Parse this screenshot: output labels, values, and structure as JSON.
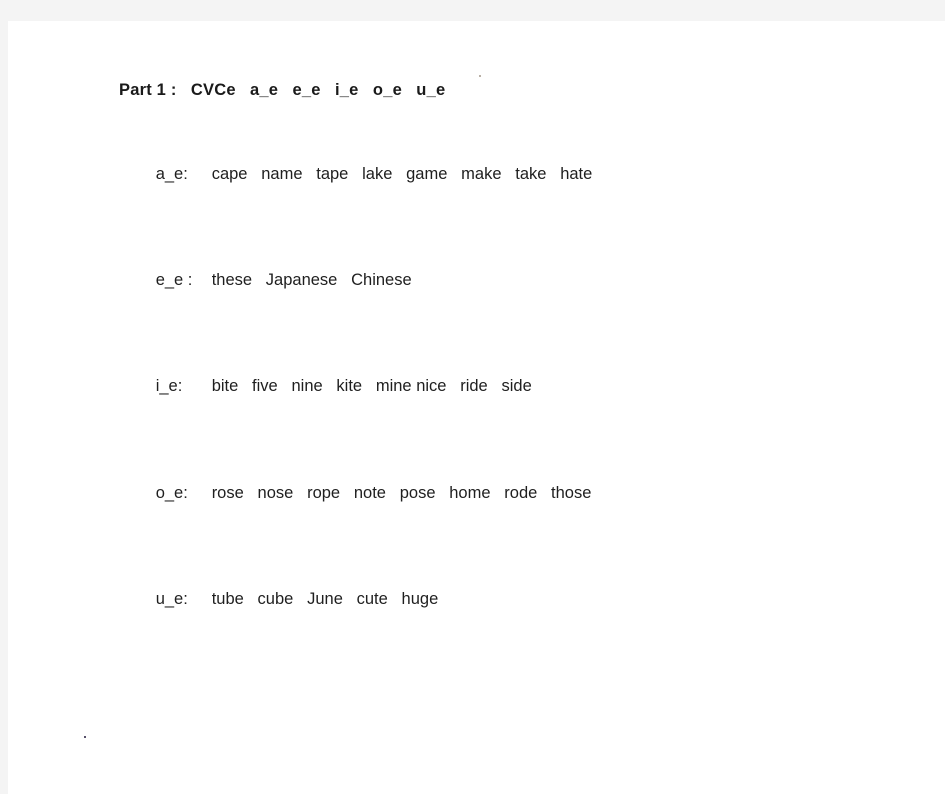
{
  "document": {
    "title_line": "Part 1 :   CVCe   a_e   e_e   i_e   o_e   u_e",
    "rows": [
      {
        "label": "a_e:",
        "words_text": "cape   name   tape   lake   game   make   take   hate",
        "words": [
          "cape",
          "name",
          "tape",
          "lake",
          "game",
          "make",
          "take",
          "hate"
        ]
      },
      {
        "label": "e_e :",
        "words_text": "these   Japanese   Chinese",
        "words": [
          "these",
          "Japanese",
          "Chinese"
        ]
      },
      {
        "label": "i_e:",
        "words_text": "bite   five   nine   kite   mine nice   ride   side",
        "words": [
          "bite",
          "five",
          "nine",
          "kite",
          "mine",
          "nice",
          "ride",
          "side"
        ]
      },
      {
        "label": "o_e:",
        "words_text": "rose   nose   rope   note   pose   home   rode   those",
        "words": [
          "rose",
          "nose",
          "rope",
          "note",
          "pose",
          "home",
          "rode",
          "those"
        ]
      },
      {
        "label": "u_e:",
        "words_text": "tube   cube   June   cute   huge",
        "words": [
          "tube",
          "cube",
          "June",
          "cute",
          "huge"
        ]
      }
    ]
  },
  "colors": {
    "canvas": "#f4f4f4",
    "page": "#ffffff",
    "text": "#1f1f1f",
    "title_text": "#1a1a1a"
  }
}
